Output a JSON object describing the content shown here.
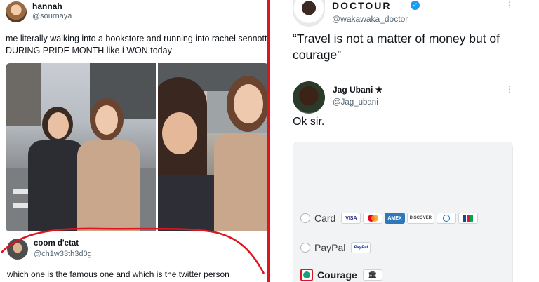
{
  "left_post": {
    "author_name": "hannah",
    "author_handle": "@sournaya",
    "text": "me literally walking into a bookstore and running into rachel sennott\nDURING PRIDE MONTH like i WON today",
    "reply": {
      "author_name": "coom d'etat",
      "author_handle": "@ch1w33th3d0g",
      "text": "which one is the famous one and which is the twitter person"
    }
  },
  "right_post": {
    "author_name": "DOCTOUR",
    "author_handle": "@wakawaka_doctor",
    "menu_icon": "more-vertical-icon",
    "verified_icon": "verified-badge-icon",
    "text": "“Travel is not a matter of money but of courage”",
    "reply": {
      "author_name": "Jag Ubani ★",
      "author_handle": "@Jag_ubani",
      "text": "Ok sir."
    },
    "payment_options": [
      {
        "label": "Card",
        "selected": false,
        "icons": [
          "VISA",
          "mastercard",
          "AMEX",
          "DISCOVER",
          "diners",
          "jcb"
        ]
      },
      {
        "label": "PayPal",
        "selected": false,
        "icons": [
          "PayPal"
        ]
      },
      {
        "label": "Courage",
        "selected": true,
        "icons": [
          "bank-icon"
        ]
      }
    ]
  },
  "colors": {
    "divider": "#e0141e",
    "scribble": "#e0141e",
    "verified": "#1d9bf0",
    "selected_radio": "#1a9e80"
  }
}
